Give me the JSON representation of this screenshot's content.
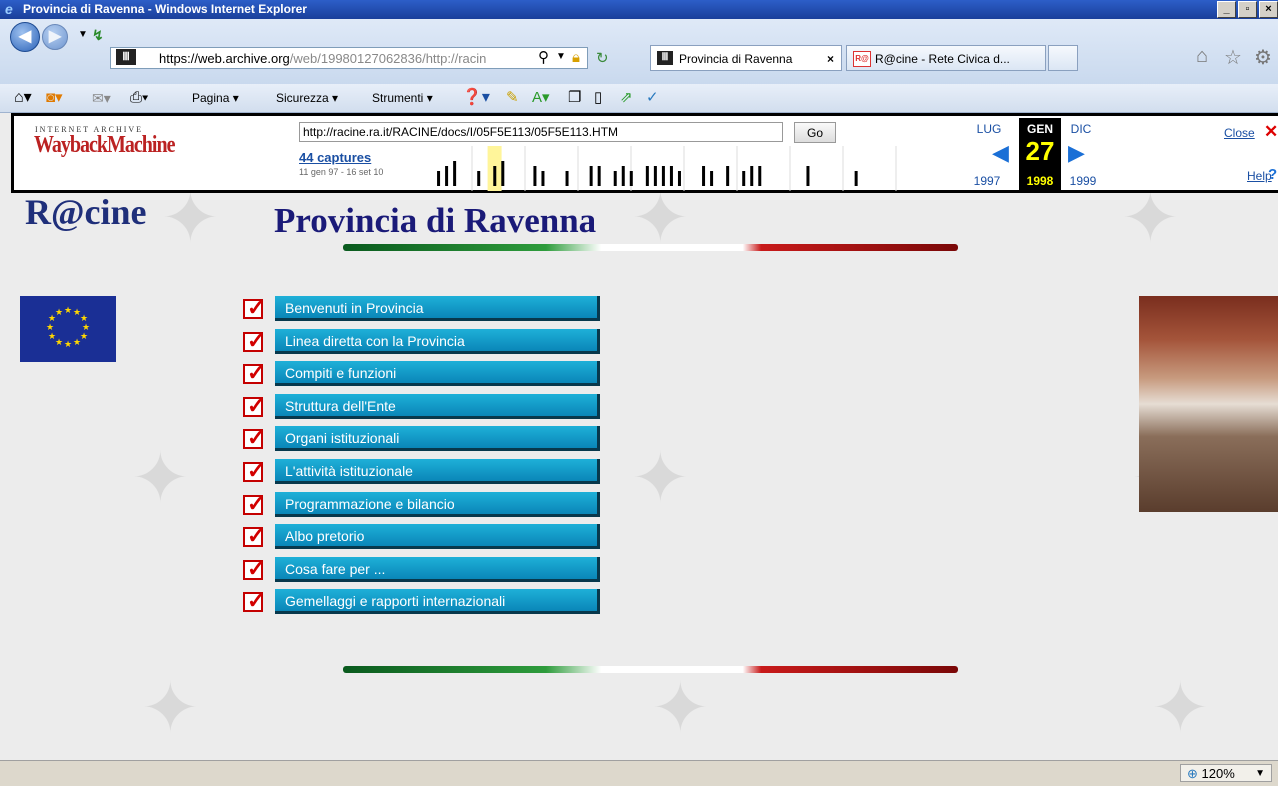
{
  "window": {
    "title": "Provincia di Ravenna - Windows Internet Explorer"
  },
  "browser": {
    "address_host": "https://web.archive.org",
    "address_rest": "/web/19980127062836/http://racin",
    "tabs": [
      {
        "label": "Provincia di Ravenna",
        "close": "×"
      },
      {
        "label": "R@cine - Rete Civica d..."
      }
    ],
    "commands": [
      "Pagina",
      "Sicurezza",
      "Strumenti"
    ],
    "zoom": "120%"
  },
  "wayback": {
    "logo_top": "INTERNET ARCHIVE",
    "logo": "WaybackMachine",
    "url": "http://racine.ra.it/RACINE/docs/I/05F5E113/05F5E113.HTM",
    "go": "Go",
    "captures": "44 captures",
    "range": "11 gen 97 - 16 set 10",
    "months": {
      "prev": "LUG",
      "current": "GEN",
      "next": "DIC"
    },
    "day": "27",
    "years": {
      "prev": "1997",
      "current": "1998",
      "next": "1999"
    },
    "close": "Close",
    "help": "Help",
    "sparkline": [
      0,
      0,
      3,
      4,
      5,
      0,
      0,
      3,
      0,
      4,
      5,
      0,
      0,
      0,
      4,
      3,
      0,
      0,
      3,
      0,
      0,
      4,
      4,
      0,
      3,
      4,
      3,
      0,
      4,
      4,
      4,
      4,
      3,
      0,
      0,
      4,
      3,
      0,
      4,
      0,
      3,
      4,
      4,
      0,
      0,
      0,
      0,
      0,
      4,
      0,
      0,
      0,
      0,
      0,
      3,
      0,
      0,
      0,
      0,
      0,
      0,
      0,
      0,
      0,
      0,
      0
    ],
    "highlight_index": 6
  },
  "page": {
    "logo": "R@cine",
    "title": "Provincia di Ravenna",
    "menu": [
      "Benvenuti in Provincia",
      "Linea diretta con la Provincia",
      "Compiti e funzioni",
      "Struttura dell'Ente",
      "Organi istituzionali",
      "L'attività istituzionale",
      "Programmazione e bilancio",
      " Albo pretorio",
      "Cosa fare per ...",
      "Gemellaggi e rapporti internazionali"
    ]
  },
  "colors": {
    "menu_button": "#0e98c6",
    "title": "#1a1a78",
    "check": "#d20000"
  }
}
